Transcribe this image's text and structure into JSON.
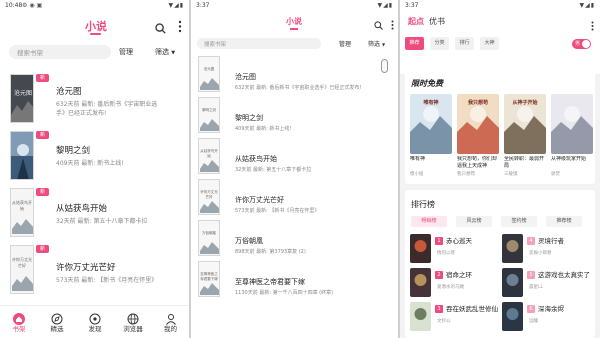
{
  "colors": {
    "accent": "#ee4c7e"
  },
  "panel1": {
    "status_time": "10:48",
    "header_title": "小说",
    "search_placeholder": "搜索书架",
    "manage": "管理",
    "filter": "筛选",
    "books": [
      {
        "title": "沧元图",
        "line1": "632天前 最新: 番后新书《宇宙职业选",
        "line2": "手》已经正式发布!",
        "badge": "新",
        "cover_text": "沧元图"
      },
      {
        "title": "黎明之剑",
        "line1": "409天前 最新: 新书上线!",
        "line2": "",
        "badge": "新",
        "cover_text": ""
      },
      {
        "title": "从姑获鸟开始",
        "line1": "32天前 最新: 第五十八章下都卡拉",
        "line2": "",
        "badge": "新",
        "cover_text": "从姑获鸟开始"
      },
      {
        "title": "许你万丈光芒好",
        "line1": "573天前 最新: 【新书《月亮在怀里》",
        "line2": "",
        "badge": "新",
        "cover_text": "许你万丈光芒好"
      }
    ],
    "tabs": [
      {
        "label": "书架",
        "icon": "home-icon",
        "active": true
      },
      {
        "label": "精选",
        "icon": "compass-icon",
        "active": false
      },
      {
        "label": "发现",
        "icon": "discover-icon",
        "active": false
      },
      {
        "label": "浏览器",
        "icon": "browser-icon",
        "active": false
      },
      {
        "label": "我的",
        "icon": "person-icon",
        "active": false
      }
    ]
  },
  "panel2": {
    "status_time": "3:37",
    "header_title": "小说",
    "search_placeholder": "搜索书架",
    "manage": "管理",
    "filter": "筛选",
    "books": [
      {
        "title": "沧元图",
        "line1": "632天前 最新: 番后新书《宇宙职业选手》已经正式发布!",
        "cover_text": "沧元图"
      },
      {
        "title": "黎明之剑",
        "line1": "409天前 最新: 新书上线!",
        "cover_text": "黎明之剑"
      },
      {
        "title": "从姑获鸟开始",
        "line1": "32天前 最新: 第五十八章下都卡拉",
        "cover_text": "从姑获鸟开始"
      },
      {
        "title": "许你万丈光芒好",
        "line1": "573天前 最新: 【新书《月亮在怀里》",
        "cover_text": "许你万丈光芒好"
      },
      {
        "title": "万俗朝凰",
        "line1": "898天前 最新: 第3793章复 (2)",
        "cover_text": "万俗朝凰"
      },
      {
        "title": "至尊神医之帝君要下嫁",
        "line1": "1130天前 最新: 第一千八百四十四章 (终章)",
        "cover_text": "至尊神医之帝君要下嫁"
      }
    ]
  },
  "panel3": {
    "status_time": "3:37",
    "brand": "起点",
    "brand_tab": "优书",
    "filters": [
      "推荐",
      "分类",
      "排行",
      "大神"
    ],
    "toggle_label": "男",
    "section_title": "限时免费",
    "free_books": [
      {
        "title": "唯有神",
        "sub": "傻小妞",
        "cover_text": "唯有神"
      },
      {
        "title": "我只想苟，你们却逼我上天成神",
        "sub": "我只想苟",
        "cover_text": "我只想苟"
      },
      {
        "title": "全民转职：最弱开局",
        "sub": "三棱镜",
        "cover_text": "从神子开始"
      },
      {
        "title": "从神级玩家开始",
        "sub": "骄焚",
        "cover_text": ""
      }
    ],
    "rank_title": "排行榜",
    "rank_tabs": [
      "畅销榜",
      "风云榜",
      "签约榜",
      "推荐榜"
    ],
    "ranks": [
      {
        "n": "1",
        "title": "赤心巡天",
        "author": "情何以甚"
      },
      {
        "n": "2",
        "title": "宿命之环",
        "author": "爱潜水的乌贼"
      },
      {
        "n": "3",
        "title": "吞在妖武乱世修仙",
        "author": "文抄公"
      },
      {
        "n": "4",
        "title": "灵境行者",
        "author": "卖报小郎君"
      },
      {
        "n": "5",
        "title": "这游戏也太真实了",
        "author": "晨星LL"
      },
      {
        "n": "6",
        "title": "深海余烬",
        "author": "远瞳"
      }
    ]
  }
}
